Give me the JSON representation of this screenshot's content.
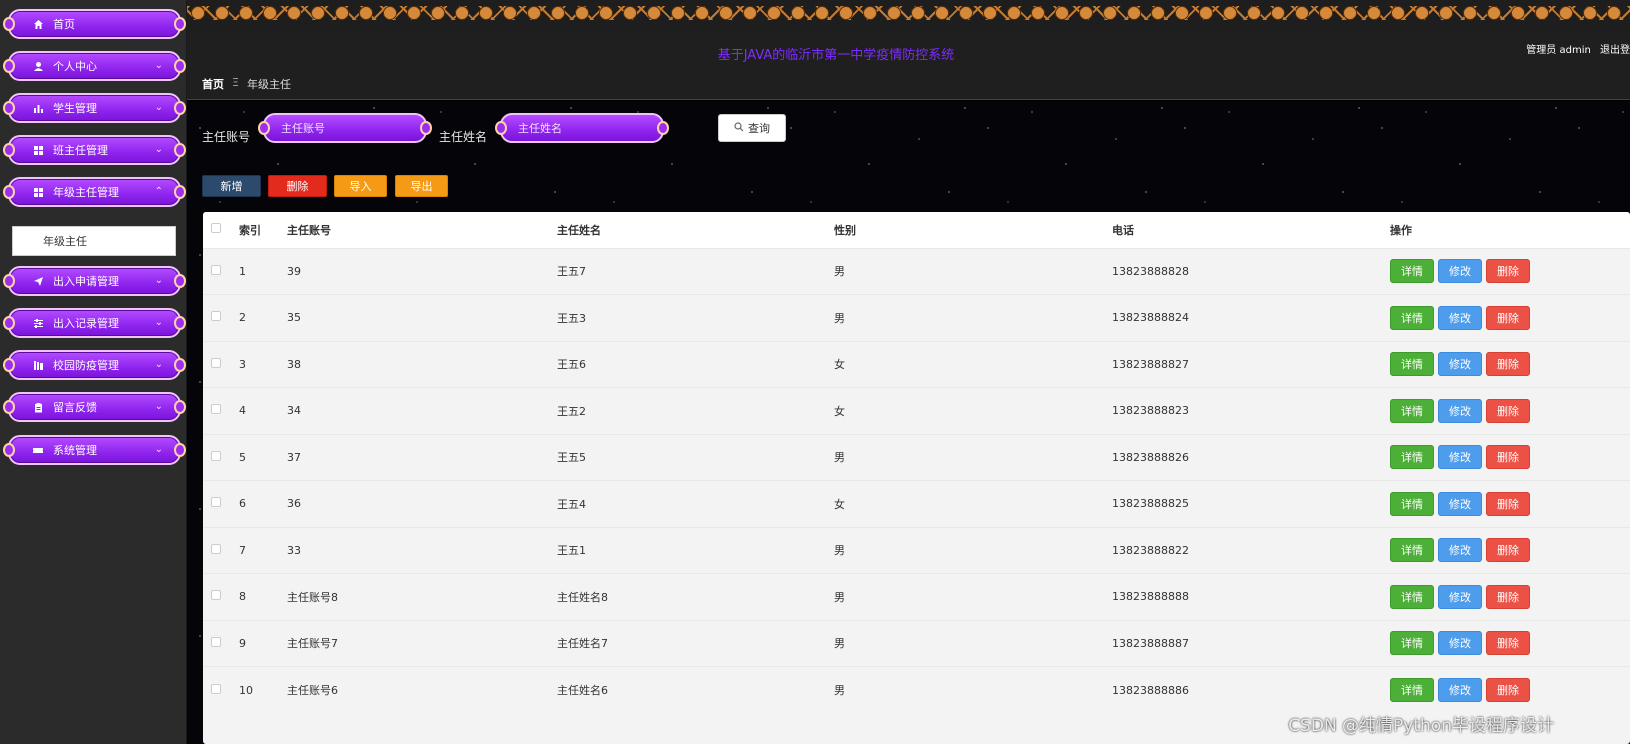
{
  "sidebar": {
    "items": [
      {
        "label": "首页",
        "icon": "home-icon",
        "has_chevron": false
      },
      {
        "label": "个人中心",
        "icon": "user-icon",
        "has_chevron": true
      },
      {
        "label": "学生管理",
        "icon": "bar-chart-icon",
        "has_chevron": true
      },
      {
        "label": "班主任管理",
        "icon": "grid-icon",
        "has_chevron": true
      },
      {
        "label": "年级主任管理",
        "icon": "grid-icon",
        "has_chevron": true,
        "expanded": true
      },
      {
        "label": "出入申请管理",
        "icon": "paper-plane-icon",
        "has_chevron": true
      },
      {
        "label": "出入记录管理",
        "icon": "sliders-icon",
        "has_chevron": true
      },
      {
        "label": "校园防疫管理",
        "icon": "library-icon",
        "has_chevron": true
      },
      {
        "label": "留言反馈",
        "icon": "clipboard-icon",
        "has_chevron": true
      },
      {
        "label": "系统管理",
        "icon": "ticket-icon",
        "has_chevron": true
      }
    ],
    "submenu": {
      "label": "年级主任"
    }
  },
  "header": {
    "title": "基于JAVA的临沂市第一中学疫情防控系统",
    "user_role": "管理员 admin",
    "logout": "退出登"
  },
  "breadcrumb": {
    "home": "首页",
    "separator": "Ξ",
    "current": "年级主任"
  },
  "search": {
    "account_label": "主任账号",
    "account_placeholder": "主任账号",
    "name_label": "主任姓名",
    "name_placeholder": "主任姓名",
    "query_button": "查询"
  },
  "actions": {
    "add": "新增",
    "delete": "删除",
    "import": "导入",
    "export": "导出"
  },
  "table": {
    "headers": {
      "index": "索引",
      "account": "主任账号",
      "name": "主任姓名",
      "gender": "性别",
      "phone": "电话",
      "ops": "操作"
    },
    "op_labels": {
      "detail": "详情",
      "edit": "修改",
      "delete": "删除"
    },
    "rows": [
      {
        "index": "1",
        "account": "39",
        "name": "王五7",
        "gender": "男",
        "phone": "13823888828"
      },
      {
        "index": "2",
        "account": "35",
        "name": "王五3",
        "gender": "男",
        "phone": "13823888824"
      },
      {
        "index": "3",
        "account": "38",
        "name": "王五6",
        "gender": "女",
        "phone": "13823888827"
      },
      {
        "index": "4",
        "account": "34",
        "name": "王五2",
        "gender": "女",
        "phone": "13823888823"
      },
      {
        "index": "5",
        "account": "37",
        "name": "王五5",
        "gender": "男",
        "phone": "13823888826"
      },
      {
        "index": "6",
        "account": "36",
        "name": "王五4",
        "gender": "女",
        "phone": "13823888825"
      },
      {
        "index": "7",
        "account": "33",
        "name": "王五1",
        "gender": "男",
        "phone": "13823888822"
      },
      {
        "index": "8",
        "account": "主任账号8",
        "name": "主任姓名8",
        "gender": "男",
        "phone": "13823888888"
      },
      {
        "index": "9",
        "account": "主任账号7",
        "name": "主任姓名7",
        "gender": "男",
        "phone": "13823888887"
      },
      {
        "index": "10",
        "account": "主任账号6",
        "name": "主任姓名6",
        "gender": "男",
        "phone": "13823888886"
      }
    ]
  },
  "watermark": "CSDN @纯情Python毕设程序设计",
  "colors": {
    "menu_purple": "#8f24ee",
    "title_purple": "#7f2cff",
    "add_button": "#2c4a6b",
    "delete_button": "#e22a1d",
    "import_button": "#f59a14",
    "detail_green": "#4caf37",
    "edit_blue": "#4e9ded",
    "delete_red": "#ec5146"
  }
}
